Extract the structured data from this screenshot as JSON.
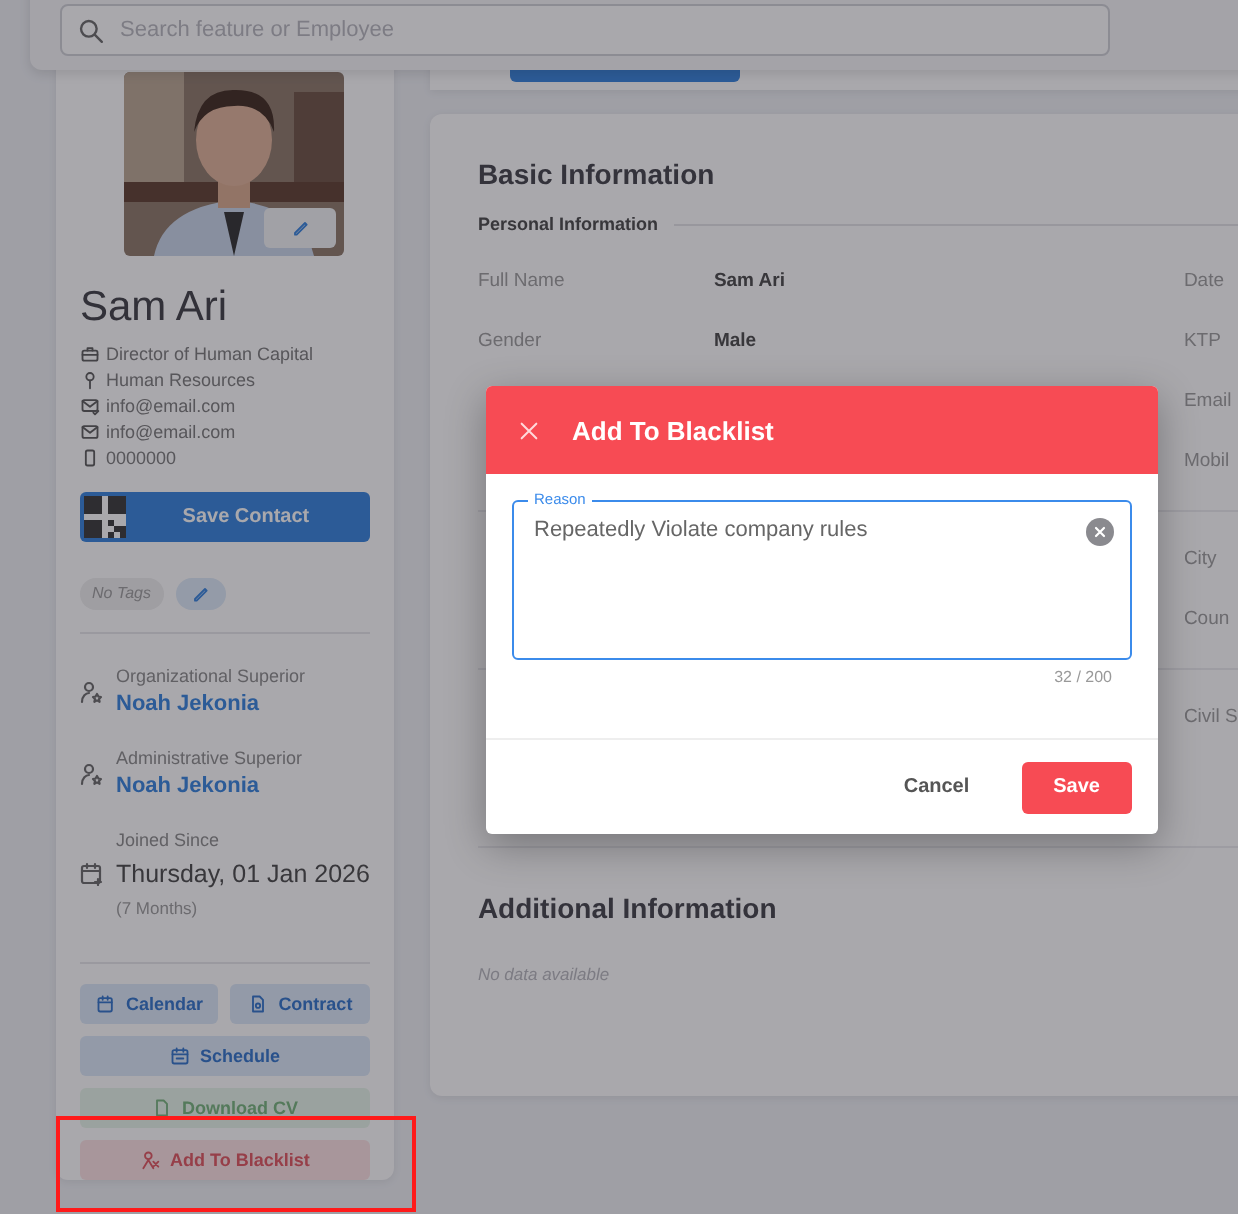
{
  "search": {
    "placeholder": "Search feature or Employee"
  },
  "profile": {
    "name": "Sam Ari",
    "details": [
      "Director of Human Capital",
      "Human Resources",
      "info@email.com",
      "info@email.com",
      "0000000"
    ],
    "save_contact": "Save Contact",
    "tags": "No Tags",
    "superiors": [
      {
        "label": "Organizational Superior",
        "name": "Noah Jekonia"
      },
      {
        "label": "Administrative Superior",
        "name": "Noah Jekonia"
      }
    ],
    "joined": {
      "label": "Joined Since",
      "date": "Thursday, 01 Jan 2026",
      "duration": "(7 Months)"
    },
    "actions": [
      {
        "label": "Calendar",
        "kind": "info",
        "disabled": false
      },
      {
        "label": "Contract",
        "kind": "info",
        "disabled": false
      },
      {
        "label": "Schedule",
        "kind": "info",
        "disabled": false
      },
      {
        "label": "Download CV",
        "kind": "success",
        "disabled": true
      },
      {
        "label": "Add To Blacklist",
        "kind": "danger",
        "disabled": false,
        "highlighted": true
      }
    ]
  },
  "basic_information": {
    "title": "Basic Information",
    "subtitle": "Personal Information",
    "groups": [
      {
        "rows": [
          {
            "label": "Full Name",
            "value": "Sam Ari",
            "side_label": "Date"
          },
          {
            "label": "Gender",
            "value": "Male",
            "side_label": "KTP"
          },
          {
            "side_label": "Email"
          },
          {
            "side_label": "Mobil"
          }
        ]
      },
      {
        "rows": [
          {
            "side_label": "City"
          },
          {
            "side_label": "Coun"
          }
        ]
      },
      {
        "rows": [
          {
            "side_label": "Civil S"
          }
        ]
      }
    ]
  },
  "additional_information": {
    "title": "Additional Information",
    "empty": "No data available"
  },
  "dialog": {
    "title": "Add To Blacklist",
    "field": {
      "label": "Reason",
      "value": "Repeatedly Violate company rules",
      "counter": "32 / 200"
    },
    "buttons": [
      {
        "label": "Cancel",
        "kind": "text"
      },
      {
        "label": "Save",
        "kind": "danger"
      }
    ]
  }
}
